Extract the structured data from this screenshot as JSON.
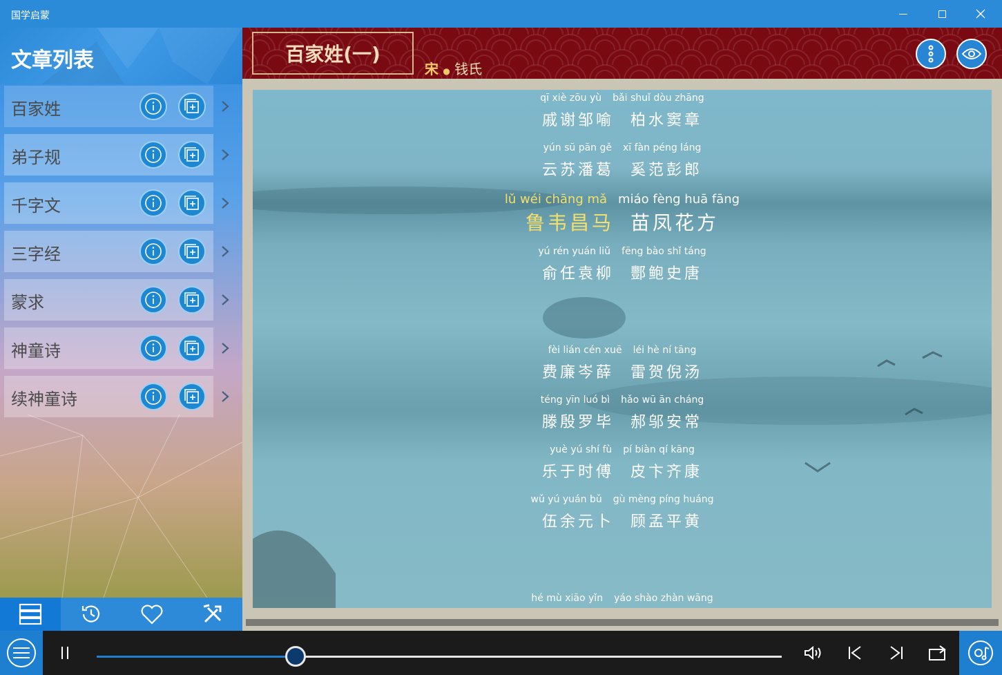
{
  "window": {
    "title": "国学启蒙"
  },
  "sidebar": {
    "title": "文章列表",
    "items": [
      {
        "label": "百家姓"
      },
      {
        "label": "弟子规"
      },
      {
        "label": "千字文"
      },
      {
        "label": "三字经"
      },
      {
        "label": "蒙求"
      },
      {
        "label": "神童诗"
      },
      {
        "label": "续神童诗"
      }
    ],
    "nav": [
      {
        "icon": "list-icon",
        "active": true
      },
      {
        "icon": "history-icon",
        "active": false
      },
      {
        "icon": "heart-icon",
        "active": false
      },
      {
        "icon": "tools-icon",
        "active": false
      }
    ]
  },
  "article": {
    "title": "百家姓(一)",
    "dynasty": "宋",
    "separator": "●",
    "author": "钱氏"
  },
  "lyrics": [
    {
      "py1": "qī xiè zōu yù",
      "py2": "bǎi shuǐ dòu zhāng",
      "hz1": "戚谢邹喻",
      "hz2": "柏水窦章",
      "highlight": false
    },
    {
      "py1": "yún sū pān gě",
      "py2": "xī fàn péng láng",
      "hz1": "云苏潘葛",
      "hz2": "奚范彭郎",
      "highlight": false
    },
    {
      "py1": "lǔ wéi chāng mǎ",
      "py2": "miáo fèng huā fāng",
      "hz1": "鲁韦昌马",
      "hz2": "苗凤花方",
      "highlight": true
    },
    {
      "py1": "yú rén yuán liǔ",
      "py2": "fēng bào shǐ táng",
      "hz1": "俞任袁柳",
      "hz2": "酆鲍史唐",
      "highlight": false
    },
    {
      "py1": "fèi lián cén xuē",
      "py2": "léi hè ní tāng",
      "hz1": "费廉岑薛",
      "hz2": "雷贺倪汤",
      "highlight": false
    },
    {
      "py1": "téng yīn luó bì",
      "py2": "hǎo wū ān cháng",
      "hz1": "滕殷罗毕",
      "hz2": "郝邬安常",
      "highlight": false
    },
    {
      "py1": "yuè yú shí fù",
      "py2": "pí biàn qí kāng",
      "hz1": "乐于时傅",
      "hz2": "皮卞齐康",
      "highlight": false
    },
    {
      "py1": "wǔ yú yuán bǔ",
      "py2": "gù mèng píng huáng",
      "hz1": "伍余元卜",
      "hz2": "顾孟平黄",
      "highlight": false
    },
    {
      "py1": "hé mù xiāo yǐn",
      "py2": "yáo shào zhàn wāng",
      "hz1": "",
      "hz2": "",
      "highlight": false
    }
  ],
  "player": {
    "progress": 0.29,
    "state": "playing"
  },
  "colors": {
    "accent": "#2b8bd8",
    "header_red": "#7a0a12",
    "highlight": "#f5e06c"
  }
}
